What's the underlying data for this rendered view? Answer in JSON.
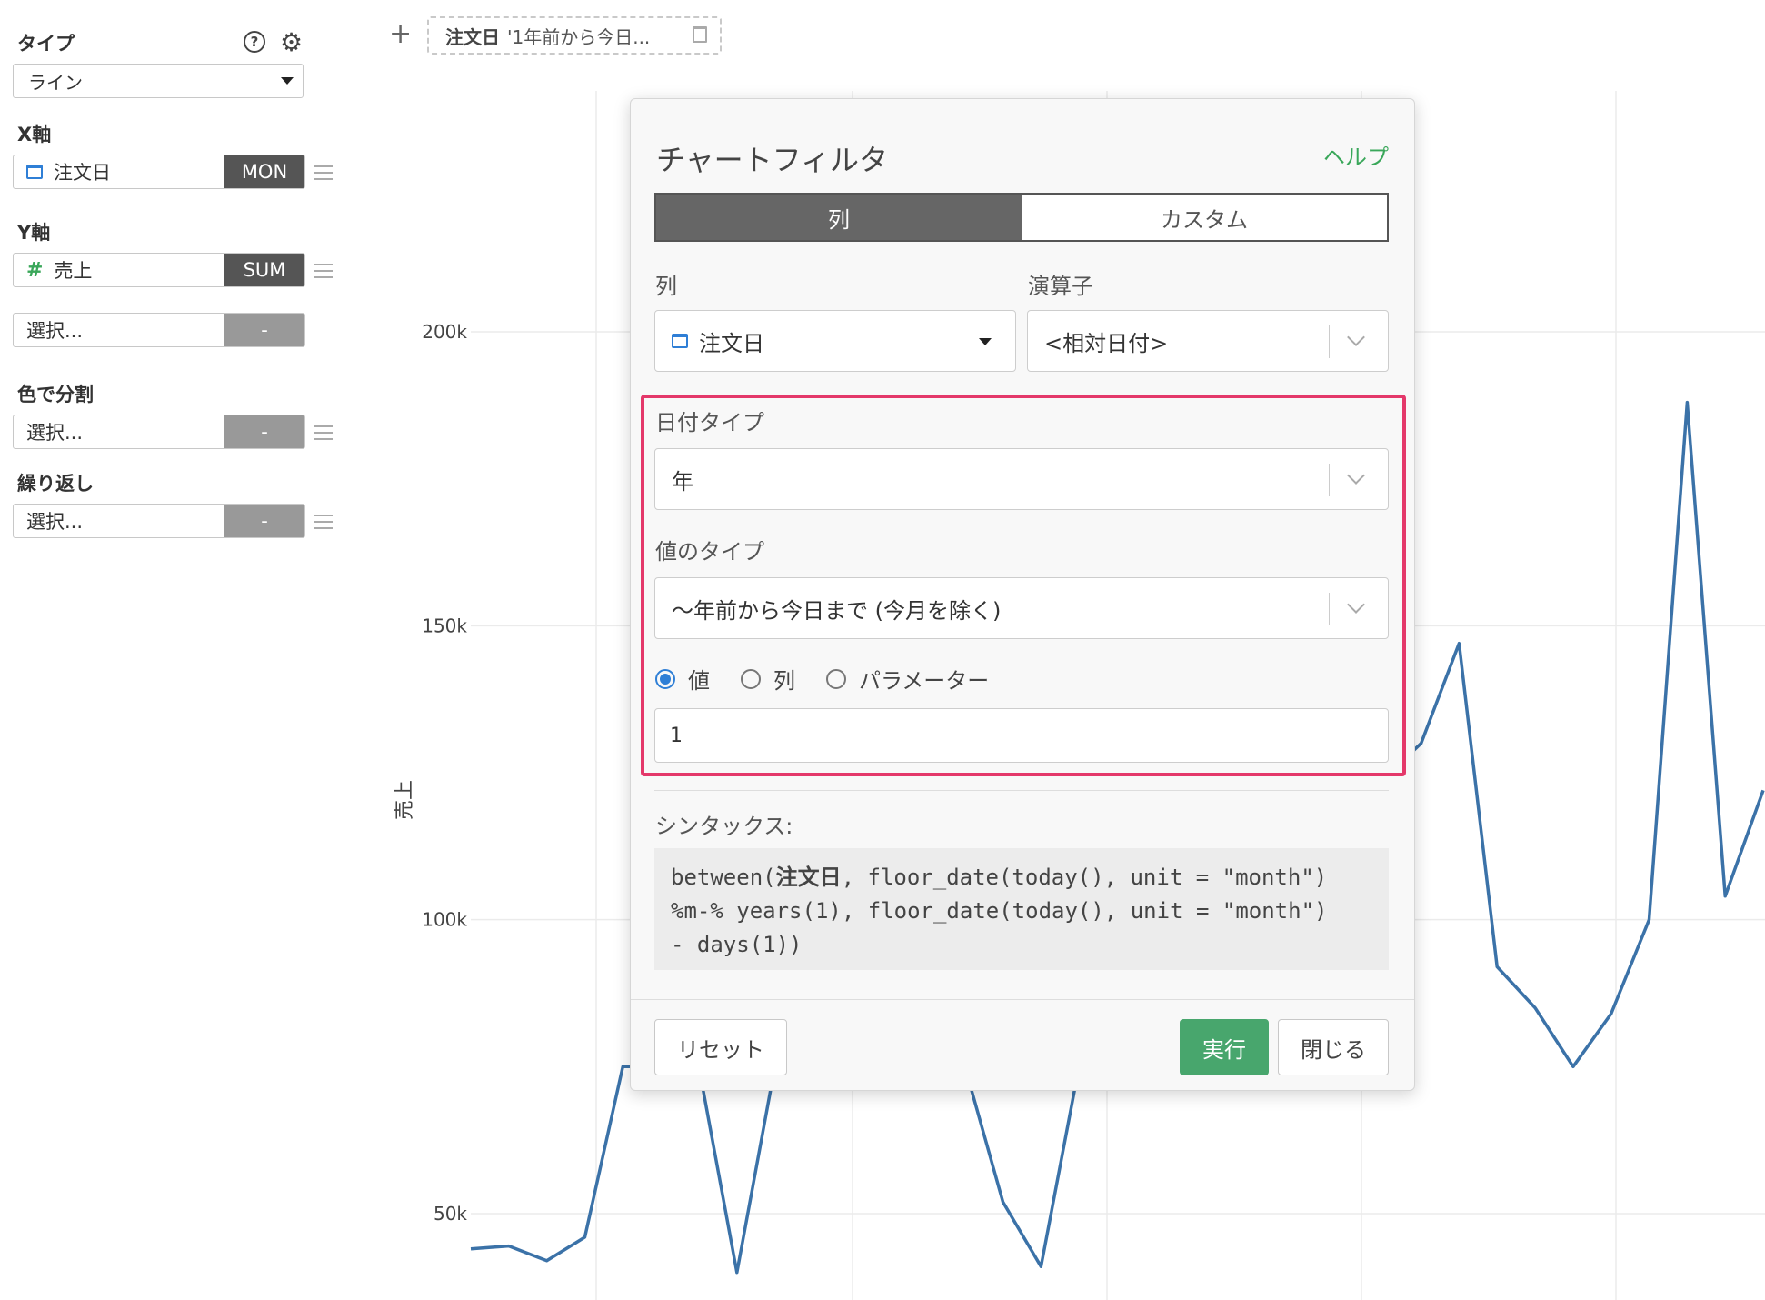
{
  "left_panel": {
    "type_label": "タイプ",
    "type_value": "ライン",
    "x_axis_label": "X軸",
    "x_axis_field": "注文日",
    "x_axis_agg": "MON",
    "y_axis_label": "Y軸",
    "y_axis_field": "売上",
    "y_axis_agg": "SUM",
    "y_axis2_placeholder": "選択...",
    "y_axis2_agg": "-",
    "color_label": "色で分割",
    "color_placeholder": "選択...",
    "color_agg": "-",
    "repeat_label": "繰り返し",
    "repeat_placeholder": "選択...",
    "repeat_agg": "-",
    "help_glyph": "?",
    "gear_glyph": "⚙"
  },
  "filter_bar": {
    "add_glyph": "+",
    "chip_column": "注文日",
    "chip_text": "'1年前から今日..."
  },
  "dialog": {
    "title": "チャートフィルタ",
    "help_link": "ヘルプ",
    "tabs": [
      "列",
      "カスタム"
    ],
    "column_label": "列",
    "column_value": "注文日",
    "operator_label": "演算子",
    "operator_value": "<相対日付>",
    "date_type_label": "日付タイプ",
    "date_type_value": "年",
    "value_type_label": "値のタイプ",
    "value_type_value": "〜年前から今日まで (今月を除く)",
    "radio_options": [
      "値",
      "列",
      "パラメーター"
    ],
    "value_input": "1",
    "syntax_label": "シンタックス:",
    "syntax_line1_pre": "between(",
    "syntax_line1_col": "注文日",
    "syntax_line1_post": ", floor_date(today(), unit = \"month\")",
    "syntax_line2": "%m-% years(1), floor_date(today(), unit = \"month\")",
    "syntax_line3": "- days(1))",
    "reset_button": "リセット",
    "run_button": "実行",
    "close_button": "閉じる"
  },
  "chart_data": {
    "type": "line",
    "ylabel": "売上",
    "yticks": [
      "50k",
      "100k",
      "150k",
      "200k"
    ],
    "ytick_values": [
      50000,
      100000,
      150000,
      200000
    ],
    "ylim": [
      35000,
      245000
    ],
    "series_color": "#3b72a8",
    "series": [
      {
        "points": [
          [
            0,
            44000
          ],
          [
            1,
            44500
          ],
          [
            2,
            42000
          ],
          [
            3,
            46000
          ],
          [
            4,
            75000
          ],
          [
            6,
            75000
          ],
          [
            7,
            40000
          ],
          [
            8,
            75000
          ],
          [
            13,
            75000
          ],
          [
            14,
            52000
          ],
          [
            15,
            41000
          ],
          [
            16,
            75000
          ],
          [
            25,
            130000
          ],
          [
            26,
            147000
          ],
          [
            27,
            92000
          ],
          [
            28,
            85000
          ],
          [
            29,
            75000
          ],
          [
            30,
            84000
          ],
          [
            31,
            100000
          ],
          [
            32,
            188000
          ],
          [
            33,
            104000
          ],
          [
            34,
            122000
          ]
        ]
      }
    ],
    "xlim": [
      0,
      34
    ]
  }
}
